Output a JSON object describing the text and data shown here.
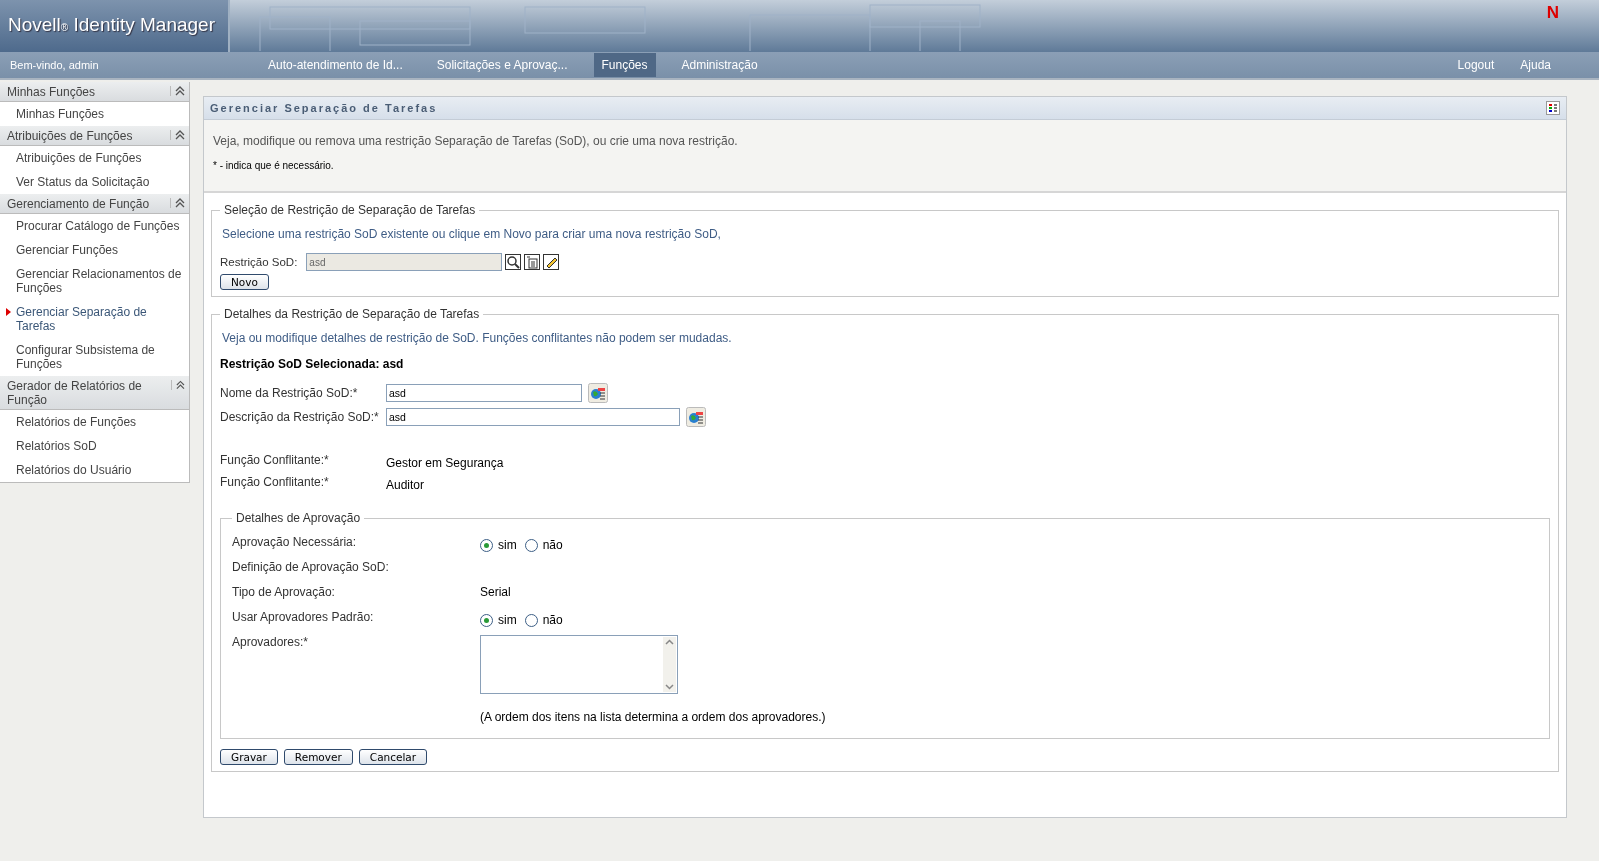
{
  "header": {
    "brand": "Novell",
    "brand_mark": "®",
    "product": "Identity Manager",
    "corner_logo": "N"
  },
  "nav": {
    "welcome": "Bem-vindo, admin",
    "tabs": [
      {
        "label": "Auto-atendimento de Id...",
        "selected": false
      },
      {
        "label": "Solicitações e Aprovaç...",
        "selected": false
      },
      {
        "label": "Funções",
        "selected": true
      },
      {
        "label": "Administração",
        "selected": false
      }
    ],
    "links": [
      "Logout",
      "Ajuda"
    ]
  },
  "sidebar": [
    {
      "title": "Minhas Funções",
      "items": [
        {
          "label": "Minhas Funções",
          "selected": false
        }
      ]
    },
    {
      "title": "Atribuições de Funções",
      "items": [
        {
          "label": "Atribuições de Funções",
          "selected": false
        },
        {
          "label": "Ver Status da Solicitação",
          "selected": false
        }
      ]
    },
    {
      "title": "Gerenciamento de Função",
      "items": [
        {
          "label": "Procurar Catálogo de Funções",
          "selected": false
        },
        {
          "label": "Gerenciar Funções",
          "selected": false
        },
        {
          "label": "Gerenciar Relacionamentos de Funções",
          "selected": false
        },
        {
          "label": "Gerenciar Separação de Tarefas",
          "selected": true
        },
        {
          "label": "Configurar Subsistema de Funções",
          "selected": false
        }
      ]
    },
    {
      "title": "Gerador de Relatórios de Função",
      "items": [
        {
          "label": "Relatórios de Funções",
          "selected": false
        },
        {
          "label": "Relatórios SoD",
          "selected": false
        },
        {
          "label": "Relatórios do Usuário",
          "selected": false
        }
      ]
    }
  ],
  "page": {
    "title": "Gerenciar Separação de Tarefas",
    "description": "Veja, modifique ou remova uma restrição Separação de Tarefas (SoD), ou crie uma nova restrição.",
    "required_note": "* - indica que é necessário.",
    "selection": {
      "legend": "Seleção de Restrição de Separação de Tarefas",
      "hint": "Selecione uma restrição SoD existente ou clique em Novo para criar uma nova restrição SoD,",
      "label": "Restrição SoD:",
      "value": "asd",
      "button": "Novo"
    },
    "details": {
      "legend": "Detalhes da Restrição de Separação de Tarefas",
      "hint": "Veja ou modifique detalhes de restrição de SoD. Funções conflitantes não podem ser mudadas.",
      "selected_heading": "Restrição SoD Selecionada: asd",
      "fields": [
        {
          "label": "Nome da Restrição SoD:*",
          "value": "asd",
          "kind": "short"
        },
        {
          "label": "Descrição da Restrição SoD:*",
          "value": "asd",
          "kind": "long"
        }
      ],
      "conflicts": [
        {
          "label": "Função Conflitante:*",
          "value": "Gestor em Segurança"
        },
        {
          "label": "Função Conflitante:*",
          "value": "Auditor"
        }
      ],
      "approval": {
        "legend": "Detalhes de Aprovação",
        "rows": [
          {
            "kind": "radio",
            "label": "Aprovação Necessária:",
            "options": [
              {
                "label": "sim",
                "selected": true
              },
              {
                "label": "não",
                "selected": false
              }
            ]
          },
          {
            "kind": "label",
            "label": "Definição de Aprovação SoD:"
          },
          {
            "kind": "text",
            "label": "Tipo de Aprovação:",
            "value": "Serial"
          },
          {
            "kind": "radio",
            "label": "Usar Aprovadores Padrão:",
            "options": [
              {
                "label": "sim",
                "selected": true
              },
              {
                "label": "não",
                "selected": false
              }
            ]
          },
          {
            "kind": "list",
            "label": "Aprovadores:*",
            "note": "(A ordem dos itens na lista determina a ordem dos aprovadores.)"
          }
        ]
      }
    },
    "buttons": [
      "Gravar",
      "Remover",
      "Cancelar"
    ]
  }
}
